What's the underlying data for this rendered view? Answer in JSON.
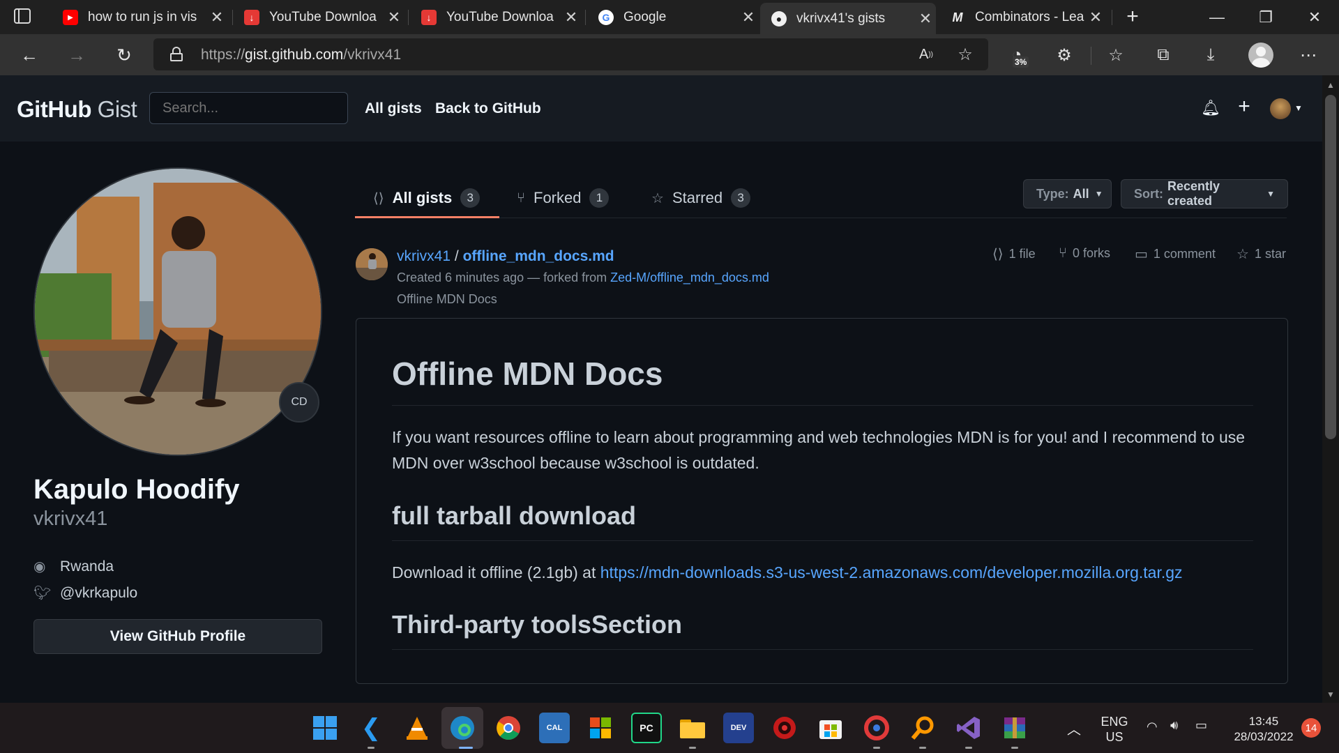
{
  "browser": {
    "tabs": [
      {
        "title": "how to run js in vis",
        "icon": "youtube-icon"
      },
      {
        "title": "YouTube Downloa",
        "icon": "download-icon"
      },
      {
        "title": "YouTube Downloa",
        "icon": "download-icon"
      },
      {
        "title": "Google",
        "icon": "google-icon"
      },
      {
        "title": "vkrivx41's gists",
        "icon": "github-icon"
      },
      {
        "title": "Combinators - Lea",
        "icon": "m-logo-icon"
      }
    ],
    "url_prefix": "https://",
    "url_host": "gist.github.com",
    "url_path": "/vkrivx41",
    "perf_badge": "3%"
  },
  "header": {
    "logo_main": "GitHub",
    "logo_sub": "Gist",
    "search_placeholder": "Search...",
    "nav": [
      "All gists",
      "Back to GitHub"
    ]
  },
  "profile": {
    "badge": "CD",
    "full_name": "Kapulo Hoodify",
    "username": "vkrivx41",
    "location": "Rwanda",
    "twitter": "@vkrkapulo",
    "view_profile_label": "View GitHub Profile"
  },
  "gist_tabs": [
    {
      "label": "All gists",
      "count": "3",
      "icon": "code-square-icon"
    },
    {
      "label": "Forked",
      "count": "1",
      "icon": "fork-icon"
    },
    {
      "label": "Starred",
      "count": "3",
      "icon": "star-icon"
    }
  ],
  "filters": {
    "type_label": "Type:",
    "type_value": "All",
    "sort_label": "Sort:",
    "sort_value": "Recently created"
  },
  "gist": {
    "owner": "vkrivx41",
    "separator": "/",
    "filename": "offline_mdn_docs.md",
    "created": "Created 6 minutes ago — forked from",
    "forked_from": "Zed-M/offline_mdn_docs.md",
    "description": "Offline MDN Docs",
    "stats": {
      "files": "1 file",
      "forks": "0 forks",
      "comments": "1 comment",
      "stars": "1 star"
    }
  },
  "content": {
    "h1": "Offline MDN Docs",
    "p1": "If you want resources offline to learn about programming and web technologies MDN is for you! and I recommend to use MDN over w3school because w3school is outdated.",
    "h2a": "full tarball download",
    "p2_prefix": "Download it offline (2.1gb) at",
    "p2_link": "https://mdn-downloads.s3-us-west-2.amazonaws.com/developer.mozilla.org.tar.gz",
    "h2b": "Third-party toolsSection"
  },
  "taskbar": {
    "lang_top": "ENG",
    "lang_bottom": "US",
    "time": "13:45",
    "date": "28/03/2022",
    "notifications": "14"
  },
  "colors": {
    "accent_link": "#58a6ff",
    "tab_underline": "#f78166",
    "page_bg": "#0d1117",
    "header_bg": "#161b22"
  }
}
